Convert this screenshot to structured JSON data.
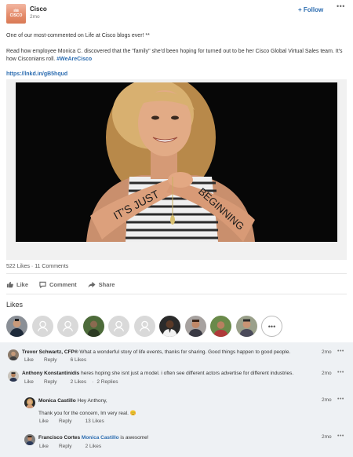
{
  "post": {
    "author": "Cisco",
    "time": "2mo",
    "follow_label": "+ Follow",
    "more_label": "•••",
    "logo": {
      "word": "CISCO",
      "bars": "ıılıılıı",
      "sub": "Cisco"
    },
    "text_line1": "One of our most-commented on Life at Cisco blogs ever! **",
    "text_line2_main": "Read how employee Monica C. discovered that the \"family\" she'd been hoping for turned out to be her Cisco Global Virtual Sales team. It's how Cisconians roll. ",
    "hashtag": "#WeAreCisco",
    "link": "https://lnkd.in/gB5hqud",
    "image_text_left": "IT'S JUST",
    "image_text_right": "BEGINNING"
  },
  "stats": {
    "likes": "522 Likes",
    "separator": "·",
    "comments": "11 Comments"
  },
  "actions": [
    {
      "label": "Like",
      "icon": "thumbs-up-icon"
    },
    {
      "label": "Comment",
      "icon": "comment-icon"
    },
    {
      "label": "Share",
      "icon": "share-icon"
    }
  ],
  "likes_section": {
    "title": "Likes",
    "more_label": "•••"
  },
  "comments": [
    {
      "name": "Trevor Schwartz, CFP®",
      "text": " What a wonderful story of life events, thanks for sharing. Good things happen to good people.",
      "like": "Like",
      "reply": "Reply",
      "likes": "6 Likes",
      "replies": "",
      "time": "2mo",
      "more": "•••"
    },
    {
      "name": "Anthony Konstantinidis",
      "text": " heres hoping she isnt just a model. i often see different actors advertise for different industries.",
      "like": "Like",
      "reply": "Reply",
      "likes": "2 Likes",
      "replies": "2 Replies",
      "time": "2mo",
      "more": "•••"
    },
    {
      "name": "Monica Castillo",
      "text": " Hey Anthony,",
      "text2": "Thank you for the concern, Im very real. 😊",
      "like": "Like",
      "reply": "Reply",
      "likes": "13 Likes",
      "replies": "",
      "time": "2mo",
      "more": "•••"
    },
    {
      "name": "Francisco Cortes",
      "mention": "Monica Castillo",
      "text": " is awesome!",
      "like": "Like",
      "reply": "Reply",
      "likes": "2 Likes",
      "replies": "",
      "time": "2mo",
      "more": "•••"
    }
  ],
  "colors": {
    "accent": "#2b6cb0",
    "comment_bg": "#eef1f4",
    "media_bg": "#f1f1f1"
  }
}
